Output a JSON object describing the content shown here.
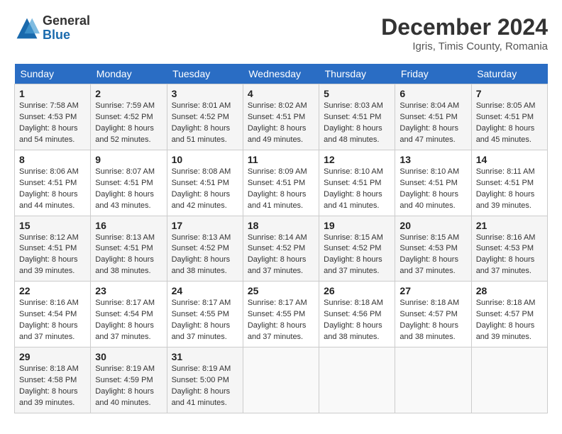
{
  "header": {
    "logo_general": "General",
    "logo_blue": "Blue",
    "month_title": "December 2024",
    "location": "Igris, Timis County, Romania"
  },
  "weekdays": [
    "Sunday",
    "Monday",
    "Tuesday",
    "Wednesday",
    "Thursday",
    "Friday",
    "Saturday"
  ],
  "weeks": [
    [
      {
        "day": "1",
        "sunrise": "7:58 AM",
        "sunset": "4:53 PM",
        "daylight": "8 hours and 54 minutes."
      },
      {
        "day": "2",
        "sunrise": "7:59 AM",
        "sunset": "4:52 PM",
        "daylight": "8 hours and 52 minutes."
      },
      {
        "day": "3",
        "sunrise": "8:01 AM",
        "sunset": "4:52 PM",
        "daylight": "8 hours and 51 minutes."
      },
      {
        "day": "4",
        "sunrise": "8:02 AM",
        "sunset": "4:51 PM",
        "daylight": "8 hours and 49 minutes."
      },
      {
        "day": "5",
        "sunrise": "8:03 AM",
        "sunset": "4:51 PM",
        "daylight": "8 hours and 48 minutes."
      },
      {
        "day": "6",
        "sunrise": "8:04 AM",
        "sunset": "4:51 PM",
        "daylight": "8 hours and 47 minutes."
      },
      {
        "day": "7",
        "sunrise": "8:05 AM",
        "sunset": "4:51 PM",
        "daylight": "8 hours and 45 minutes."
      }
    ],
    [
      {
        "day": "8",
        "sunrise": "8:06 AM",
        "sunset": "4:51 PM",
        "daylight": "8 hours and 44 minutes."
      },
      {
        "day": "9",
        "sunrise": "8:07 AM",
        "sunset": "4:51 PM",
        "daylight": "8 hours and 43 minutes."
      },
      {
        "day": "10",
        "sunrise": "8:08 AM",
        "sunset": "4:51 PM",
        "daylight": "8 hours and 42 minutes."
      },
      {
        "day": "11",
        "sunrise": "8:09 AM",
        "sunset": "4:51 PM",
        "daylight": "8 hours and 41 minutes."
      },
      {
        "day": "12",
        "sunrise": "8:10 AM",
        "sunset": "4:51 PM",
        "daylight": "8 hours and 41 minutes."
      },
      {
        "day": "13",
        "sunrise": "8:10 AM",
        "sunset": "4:51 PM",
        "daylight": "8 hours and 40 minutes."
      },
      {
        "day": "14",
        "sunrise": "8:11 AM",
        "sunset": "4:51 PM",
        "daylight": "8 hours and 39 minutes."
      }
    ],
    [
      {
        "day": "15",
        "sunrise": "8:12 AM",
        "sunset": "4:51 PM",
        "daylight": "8 hours and 39 minutes."
      },
      {
        "day": "16",
        "sunrise": "8:13 AM",
        "sunset": "4:51 PM",
        "daylight": "8 hours and 38 minutes."
      },
      {
        "day": "17",
        "sunrise": "8:13 AM",
        "sunset": "4:52 PM",
        "daylight": "8 hours and 38 minutes."
      },
      {
        "day": "18",
        "sunrise": "8:14 AM",
        "sunset": "4:52 PM",
        "daylight": "8 hours and 37 minutes."
      },
      {
        "day": "19",
        "sunrise": "8:15 AM",
        "sunset": "4:52 PM",
        "daylight": "8 hours and 37 minutes."
      },
      {
        "day": "20",
        "sunrise": "8:15 AM",
        "sunset": "4:53 PM",
        "daylight": "8 hours and 37 minutes."
      },
      {
        "day": "21",
        "sunrise": "8:16 AM",
        "sunset": "4:53 PM",
        "daylight": "8 hours and 37 minutes."
      }
    ],
    [
      {
        "day": "22",
        "sunrise": "8:16 AM",
        "sunset": "4:54 PM",
        "daylight": "8 hours and 37 minutes."
      },
      {
        "day": "23",
        "sunrise": "8:17 AM",
        "sunset": "4:54 PM",
        "daylight": "8 hours and 37 minutes."
      },
      {
        "day": "24",
        "sunrise": "8:17 AM",
        "sunset": "4:55 PM",
        "daylight": "8 hours and 37 minutes."
      },
      {
        "day": "25",
        "sunrise": "8:17 AM",
        "sunset": "4:55 PM",
        "daylight": "8 hours and 37 minutes."
      },
      {
        "day": "26",
        "sunrise": "8:18 AM",
        "sunset": "4:56 PM",
        "daylight": "8 hours and 38 minutes."
      },
      {
        "day": "27",
        "sunrise": "8:18 AM",
        "sunset": "4:57 PM",
        "daylight": "8 hours and 38 minutes."
      },
      {
        "day": "28",
        "sunrise": "8:18 AM",
        "sunset": "4:57 PM",
        "daylight": "8 hours and 39 minutes."
      }
    ],
    [
      {
        "day": "29",
        "sunrise": "8:18 AM",
        "sunset": "4:58 PM",
        "daylight": "8 hours and 39 minutes."
      },
      {
        "day": "30",
        "sunrise": "8:19 AM",
        "sunset": "4:59 PM",
        "daylight": "8 hours and 40 minutes."
      },
      {
        "day": "31",
        "sunrise": "8:19 AM",
        "sunset": "5:00 PM",
        "daylight": "8 hours and 41 minutes."
      },
      null,
      null,
      null,
      null
    ]
  ],
  "labels": {
    "sunrise": "Sunrise:",
    "sunset": "Sunset:",
    "daylight": "Daylight:"
  }
}
